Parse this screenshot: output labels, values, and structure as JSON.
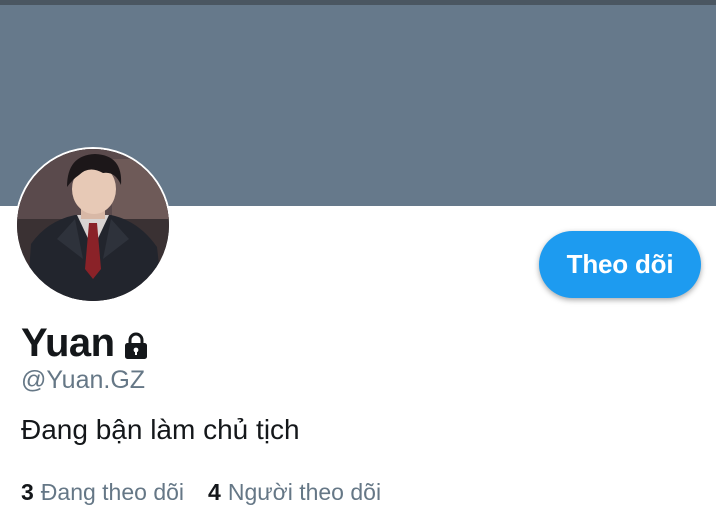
{
  "profile": {
    "display_name": "Yuan",
    "handle": "@Yuan.GZ",
    "bio": "Đang bận làm chủ tịch",
    "protected": true,
    "avatar_icon": "profile-photo"
  },
  "actions": {
    "follow_label": "Theo dõi"
  },
  "stats": {
    "following_count": "3",
    "following_label": "Đang theo dõi",
    "followers_count": "4",
    "followers_label": "Người theo dõi"
  },
  "colors": {
    "banner": "#66798b",
    "accent": "#1d9bf0",
    "text_primary": "#14171a",
    "text_secondary": "#657786"
  }
}
